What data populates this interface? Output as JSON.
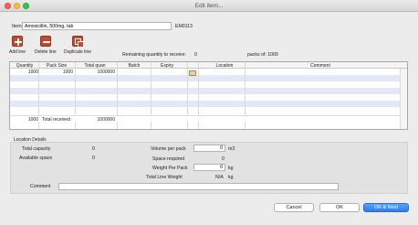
{
  "window": {
    "title": "Edit item..."
  },
  "item": {
    "label": "Item",
    "value": "Amoxicillin, 500mg, tab",
    "code": "EM0113"
  },
  "toolbar": {
    "add_label": "Add line",
    "delete_label": "Delete line",
    "duplicate_label": "Duplicate line"
  },
  "remaining": {
    "label": "Remaining quantity to receive:",
    "value": "0",
    "packs_label": "packs of: 1000"
  },
  "table": {
    "headers": [
      "Quantity",
      "Pack Size",
      "Total quan",
      "Batch",
      "Expiry",
      "Location",
      "Comment"
    ],
    "row1": {
      "quantity": "1000",
      "pack_size": "1000",
      "total": "1000000"
    },
    "totals": {
      "quantity": "1000",
      "label": "Total received",
      "total": "1000000"
    }
  },
  "location": {
    "section_title": "Location Details",
    "total_capacity_label": "Total capacity",
    "total_capacity_value": "0",
    "available_space_label": "Available space",
    "available_space_value": "0",
    "volume_per_pack_label": "Volume per pack",
    "volume_per_pack_value": "0",
    "volume_unit": "m3",
    "space_required_label": "Space required",
    "space_required_value": "0",
    "weight_per_pack_label": "Weight Per Pack",
    "weight_per_pack_value": "0",
    "weight_unit": "kg",
    "total_line_weight_label": "Total Line Weight",
    "total_line_weight_value": "N/A",
    "total_line_weight_unit": "kg",
    "comment_label": "Comment"
  },
  "buttons": {
    "cancel": "Cancel",
    "ok": "OK",
    "ok_next": "OK & Next"
  },
  "colors": {
    "accent": "#2a7ff0",
    "row_alt": "#e3e8f7",
    "tool_icon": "#c6472d"
  }
}
